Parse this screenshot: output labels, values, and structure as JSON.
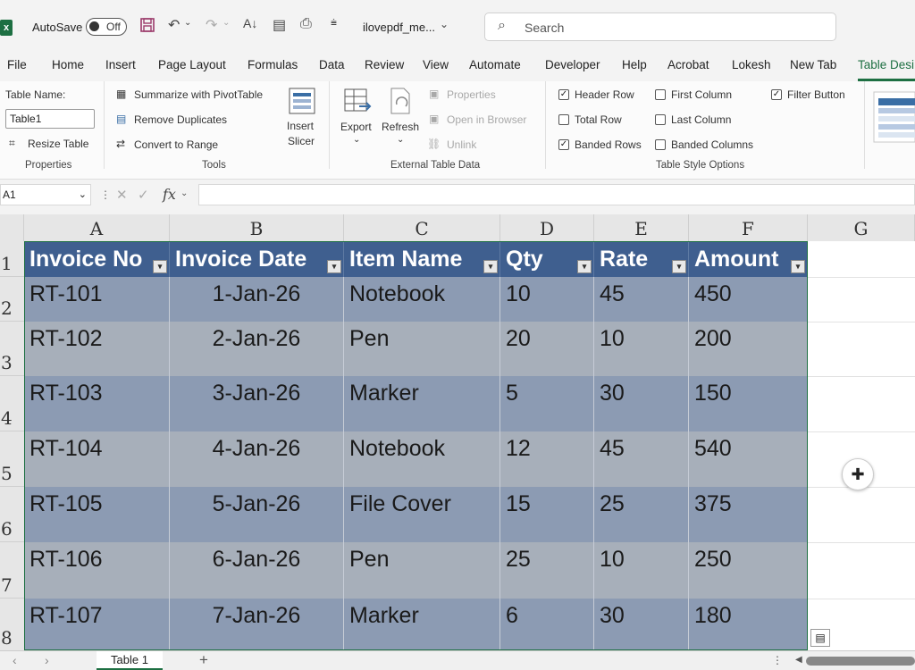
{
  "titlebar": {
    "autosave_label": "AutoSave",
    "autosave_state": "Off",
    "file_name": "ilovepdf_me...",
    "search_placeholder": "Search"
  },
  "menu": [
    "File",
    "Home",
    "Insert",
    "Page Layout",
    "Formulas",
    "Data",
    "Review",
    "View",
    "Automate",
    "Developer",
    "Help",
    "Acrobat",
    "Lokesh",
    "New Tab",
    "Table Desi"
  ],
  "ribbon": {
    "properties": {
      "table_name_label": "Table Name:",
      "table_name_value": "Table1",
      "resize_label": "Resize Table",
      "group": "Properties"
    },
    "tools": {
      "summarize": "Summarize with PivotTable",
      "remove_dup": "Remove Duplicates",
      "convert": "Convert to Range",
      "insert_slicer_1": "Insert",
      "insert_slicer_2": "Slicer",
      "group": "Tools"
    },
    "external": {
      "export": "Export",
      "refresh": "Refresh",
      "properties": "Properties",
      "open_browser": "Open in Browser",
      "unlink": "Unlink",
      "group": "External Table Data"
    },
    "style_options": {
      "header_row": "Header Row",
      "total_row": "Total Row",
      "banded_rows": "Banded Rows",
      "first_column": "First Column",
      "last_column": "Last Column",
      "banded_columns": "Banded Columns",
      "filter_button": "Filter Button",
      "group": "Table Style Options"
    }
  },
  "formula_bar": {
    "name_box": "A1",
    "fx": "fx"
  },
  "columns": [
    "A",
    "B",
    "C",
    "D",
    "E",
    "F",
    "G"
  ],
  "rows": [
    "1",
    "2",
    "3",
    "4",
    "5",
    "6",
    "7",
    "8"
  ],
  "table": {
    "headers": [
      "Invoice No",
      "Invoice Date",
      "Item Name",
      "Qty",
      "Rate",
      "Amount"
    ],
    "data": [
      [
        "RT-101",
        "1-Jan-26",
        "Notebook",
        "10",
        "45",
        "450"
      ],
      [
        "RT-102",
        "2-Jan-26",
        "Pen",
        "20",
        "10",
        "200"
      ],
      [
        "RT-103",
        "3-Jan-26",
        "Marker",
        "5",
        "30",
        "150"
      ],
      [
        "RT-104",
        "4-Jan-26",
        "Notebook",
        "12",
        "45",
        "540"
      ],
      [
        "RT-105",
        "5-Jan-26",
        "File Cover",
        "15",
        "25",
        "375"
      ],
      [
        "RT-106",
        "6-Jan-26",
        "Pen",
        "25",
        "10",
        "250"
      ],
      [
        "RT-107",
        "7-Jan-26",
        "Marker",
        "6",
        "30",
        "180"
      ]
    ]
  },
  "sheet_tabs": {
    "active": "Table 1",
    "add": "+"
  },
  "colors": {
    "header": "#3f5f8f",
    "band_dark": "#8c9bb3",
    "band_light": "#a7afba",
    "accent": "#1d6f42"
  }
}
